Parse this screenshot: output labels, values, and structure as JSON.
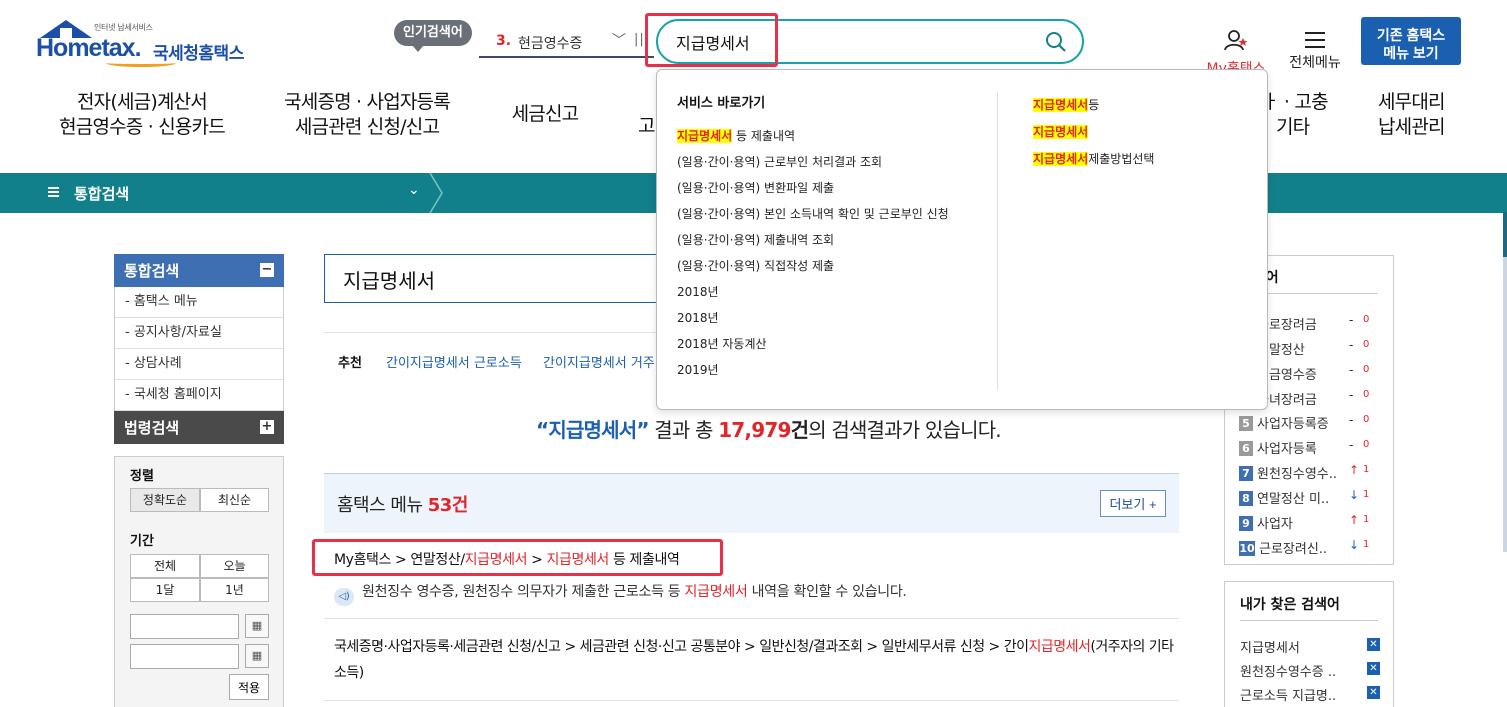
{
  "header": {
    "logo_small": "인터넷 납세서비스",
    "logo_wordmark": "Hometax.",
    "logo_kor": "국세청홈택스",
    "popular_badge": "인기검색어",
    "popular_rank_num": "3.",
    "popular_rank_keyword": "현금영수증",
    "search_value": "지급명세서",
    "my_hometax": "My홈택스",
    "all_menu": "전체메뉴",
    "old_hometax_line1": "기존 홈택스",
    "old_hometax_line2": "메뉴 보기"
  },
  "gnb": [
    {
      "l1": "전자(세금)계산서",
      "l2": "현금영수증 · 신용카드"
    },
    {
      "l1": "국세증명 · 사업자등록",
      "l2": "세금관련 신청/신고"
    },
    {
      "l1": "세금신고",
      "l2": ""
    },
    {
      "l1": "고",
      "l2": ""
    },
    {
      "l1": "ㅏ · 고충",
      "l2": "기타"
    },
    {
      "l1": "세무대리",
      "l2": "납세관리"
    }
  ],
  "teal_bar": {
    "title": "통합검색"
  },
  "sidebar": {
    "search_head": "통합검색",
    "items": [
      "- 홈택스 메뉴",
      "- 공지사항/자료실",
      "- 상담사례",
      "- 국세청 홈페이지"
    ],
    "law_head": "법령검색",
    "sort_label": "정렬",
    "sort_options": [
      "정확도순",
      "최신순"
    ],
    "period_label": "기간",
    "period_options": [
      "전체",
      "오늘",
      "1달",
      "1년"
    ],
    "apply_label": "적용"
  },
  "main": {
    "search_value": "지급명세서",
    "recommend_label": "추천",
    "recommend_items": [
      "간이지급명세서 근로소득",
      "간이지급명세서 거주"
    ],
    "result": {
      "q": "“지급명세서”",
      "t1": " 결과 총 ",
      "n": "17,979",
      "t2": "건",
      "t3": "의 검색결과가 있습니다."
    },
    "menu_section": {
      "title": "홈택스 메뉴 ",
      "count": "53건",
      "more": "더보기"
    },
    "result1": {
      "p1": "My홈택스 > 연말정산/",
      "hl1": "지급명세서",
      "p2": " > ",
      "hl2": "지급명세서",
      "p3": " 등 제출내역",
      "d1": "원천징수 영수증, 원천징수 의무자가 제출한 근로소득 등 ",
      "dhl": "지급명세서",
      "d2": " 내역을 확인할 수 있습니다."
    },
    "result2": {
      "p1": "국세증명·사업자등록·세금관련 신청/신고 > 세금관련 신청·신고 공통분야 > 일반신청/결과조회 > 일반세무서류 신청 > 간이",
      "hl": "지급명세서",
      "p2": "(거주자의 기타소득)"
    }
  },
  "rank_panel": {
    "title": "검색어",
    "items": [
      {
        "rank": "",
        "kw": "근로장려금",
        "change": "-",
        "val": "0"
      },
      {
        "rank": "",
        "kw": "연말정산",
        "change": "-",
        "val": "0"
      },
      {
        "rank": "",
        "kw": "현금영수증",
        "change": "-",
        "val": "0"
      },
      {
        "rank": "",
        "kw": "자녀장려금",
        "change": "-",
        "val": "0"
      },
      {
        "rank": "5",
        "kw": "사업자등록증",
        "change": "-",
        "val": "0"
      },
      {
        "rank": "6",
        "kw": "사업자등록",
        "change": "-",
        "val": "0"
      },
      {
        "rank": "7",
        "kw": "원천징수영수..",
        "change": "↑",
        "val": "1"
      },
      {
        "rank": "8",
        "kw": "연말정산 미..",
        "change": "↓",
        "val": "1"
      },
      {
        "rank": "9",
        "kw": "사업자",
        "change": "↑",
        "val": "1"
      },
      {
        "rank": "10",
        "kw": "근로장려신..",
        "change": "↓",
        "val": "1"
      }
    ]
  },
  "mine_panel": {
    "title": "내가 찾은 검색어",
    "items": [
      "지급명세서",
      "원천징수영수증 ..",
      "근로소득 지급명.."
    ]
  },
  "dropdown": {
    "heading": "서비스 바로가기",
    "first_hl": "지급명세서",
    "first_rest": " 등 제출내역",
    "items": [
      "(일용·간이·용역) 근로부인 처리결과 조회",
      "(일용·간이·용역) 변환파일 제출",
      "(일용·간이·용역) 본인 소득내역 확인 및 근로부인 신청",
      "(일용·간이·용역) 제출내역 조회",
      "(일용·간이·용역) 직접작성 제출",
      "2018년",
      "2018년",
      "2018년 자동계산",
      "2019년"
    ],
    "right": [
      {
        "hl": "지급명세서",
        "rest": "등"
      },
      {
        "hl": "지급명세서",
        "rest": ""
      },
      {
        "hl": "지급명세서",
        "rest": "제출방법선택"
      }
    ]
  },
  "colors": {
    "teal": "#12808a",
    "brand_blue": "#1b5fb0",
    "highlight_red": "#e0262b",
    "focus_rect": "#e8304a"
  }
}
